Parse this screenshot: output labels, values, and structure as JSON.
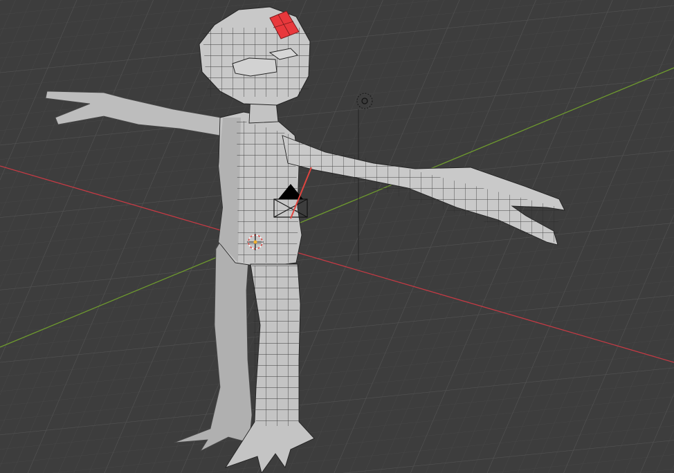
{
  "viewport": {
    "mode": "edit-mode",
    "background_color": "#3d3d3d",
    "grid_minor_color": "#474747",
    "grid_major_color": "#525252",
    "x_axis_color": "#c43a44",
    "y_axis_color": "#6e9a2e",
    "mesh_fill_color": "#c6c6c6",
    "mesh_shade_color": "#a9a9a9",
    "wire_color": "#222222",
    "selected_face_color": "#e8383c"
  },
  "scene_objects": {
    "mesh": "character-mesh",
    "camera": "camera-object",
    "light": "light-object",
    "cursor": "3d-cursor"
  }
}
